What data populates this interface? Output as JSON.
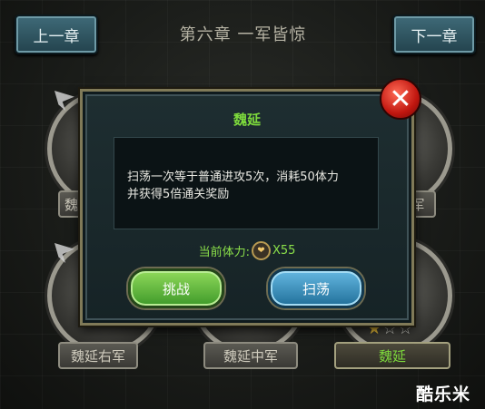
{
  "header": {
    "prev_label": "上一章",
    "next_label": "下一章",
    "chapter_title": "第六章 一军皆惊"
  },
  "stage_nodes": [
    {
      "label": "魏延"
    },
    {
      "label": "军"
    },
    {
      "label": "魏延右军"
    },
    {
      "label": "魏延中军"
    },
    {
      "label": "魏延",
      "stars": 1,
      "max_stars": 3
    }
  ],
  "dialog": {
    "title": "魏延",
    "message_line1": "扫荡一次等于普通进攻5次，消耗50体力",
    "message_line2": "并获得5倍通关奖励",
    "stamina_label": "当前体力:",
    "stamina_value": "X55",
    "challenge_label": "挑战",
    "sweep_label": "扫荡",
    "close_glyph": "✕"
  },
  "watermark": "酷乐米",
  "colors": {
    "accent_green": "#7edb3c",
    "button_blue": "#2f86b4",
    "close_red": "#c0160f"
  }
}
